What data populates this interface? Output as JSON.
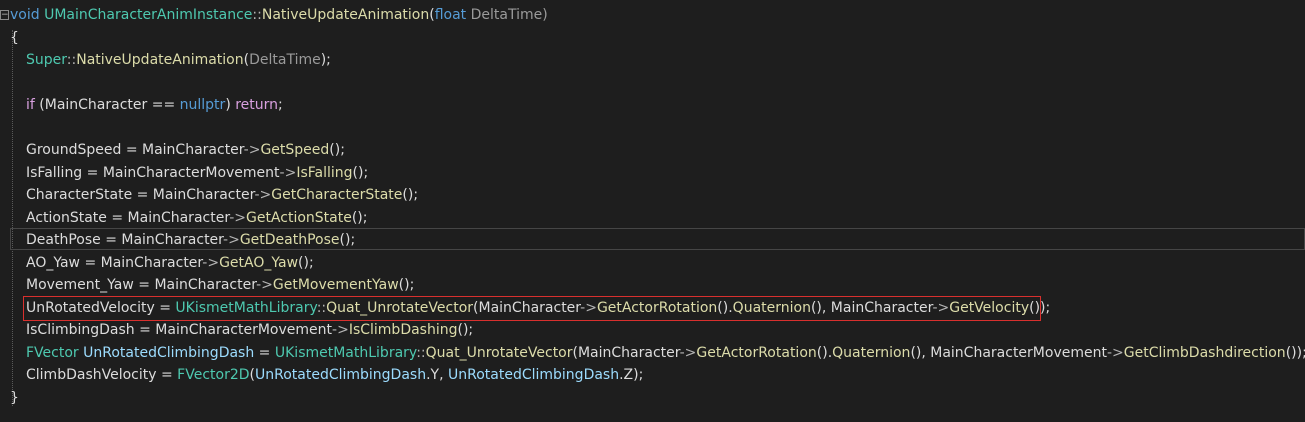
{
  "editor": {
    "lines": [
      [
        {
          "t": "void",
          "c": "kw"
        },
        {
          "t": " ",
          "c": "txt"
        },
        {
          "t": "UMainCharacterAnimInstance",
          "c": "ty"
        },
        {
          "t": "::",
          "c": "op"
        },
        {
          "t": "NativeUpdateAnimation",
          "c": "fn"
        },
        {
          "t": "(",
          "c": "txt"
        },
        {
          "t": "float",
          "c": "kw"
        },
        {
          "t": " DeltaTime)",
          "c": "param"
        }
      ],
      [
        {
          "t": "{",
          "c": "txt"
        }
      ],
      [
        {
          "t": "Super",
          "c": "ty"
        },
        {
          "t": "::",
          "c": "op"
        },
        {
          "t": "NativeUpdateAnimation",
          "c": "fn"
        },
        {
          "t": "(",
          "c": "txt"
        },
        {
          "t": "DeltaTime",
          "c": "param"
        },
        {
          "t": ");",
          "c": "txt"
        }
      ],
      [],
      [
        {
          "t": "if",
          "c": "ctl"
        },
        {
          "t": " (MainCharacter == ",
          "c": "txt"
        },
        {
          "t": "nullptr",
          "c": "kw"
        },
        {
          "t": ") ",
          "c": "txt"
        },
        {
          "t": "return",
          "c": "ctl"
        },
        {
          "t": ";",
          "c": "txt"
        }
      ],
      [],
      [
        {
          "t": "GroundSpeed = MainCharacter",
          "c": "txt"
        },
        {
          "t": "->",
          "c": "op"
        },
        {
          "t": "GetSpeed",
          "c": "fn"
        },
        {
          "t": "();",
          "c": "txt"
        }
      ],
      [
        {
          "t": "IsFalling = MainCharacterMovement",
          "c": "txt"
        },
        {
          "t": "->",
          "c": "op"
        },
        {
          "t": "IsFalling",
          "c": "fn"
        },
        {
          "t": "();",
          "c": "txt"
        }
      ],
      [
        {
          "t": "CharacterState = MainCharacter",
          "c": "txt"
        },
        {
          "t": "->",
          "c": "op"
        },
        {
          "t": "GetCharacterState",
          "c": "fn"
        },
        {
          "t": "();",
          "c": "txt"
        }
      ],
      [
        {
          "t": "ActionState = MainCharacter",
          "c": "txt"
        },
        {
          "t": "->",
          "c": "op"
        },
        {
          "t": "GetActionState",
          "c": "fn"
        },
        {
          "t": "();",
          "c": "txt"
        }
      ],
      [
        {
          "t": "DeathPose = MainCharacter",
          "c": "txt"
        },
        {
          "t": "->",
          "c": "op"
        },
        {
          "t": "GetDeathPose",
          "c": "fn"
        },
        {
          "t": "();",
          "c": "txt"
        }
      ],
      [
        {
          "t": "AO_Yaw = MainCharacter",
          "c": "txt"
        },
        {
          "t": "->",
          "c": "op"
        },
        {
          "t": "GetAO_Yaw",
          "c": "fn"
        },
        {
          "t": "();",
          "c": "txt"
        }
      ],
      [
        {
          "t": "Movement_Yaw = MainCharacter",
          "c": "txt"
        },
        {
          "t": "->",
          "c": "op"
        },
        {
          "t": "GetMovementYaw",
          "c": "fn"
        },
        {
          "t": "();",
          "c": "txt"
        }
      ],
      [
        {
          "t": "UnRotatedVelocity = ",
          "c": "txt"
        },
        {
          "t": "UKismetMathLibrary",
          "c": "ty"
        },
        {
          "t": "::",
          "c": "op"
        },
        {
          "t": "Quat_UnrotateVector",
          "c": "fn"
        },
        {
          "t": "(MainCharacter",
          "c": "txt"
        },
        {
          "t": "->",
          "c": "op"
        },
        {
          "t": "GetActorRotation",
          "c": "fn"
        },
        {
          "t": "().",
          "c": "txt"
        },
        {
          "t": "Quaternion",
          "c": "fn"
        },
        {
          "t": "(), MainCharacter",
          "c": "txt"
        },
        {
          "t": "->",
          "c": "op"
        },
        {
          "t": "GetVelocity",
          "c": "fn"
        },
        {
          "t": "());",
          "c": "txt"
        }
      ],
      [
        {
          "t": "IsClimbingDash = MainCharacterMovement",
          "c": "txt"
        },
        {
          "t": "->",
          "c": "op"
        },
        {
          "t": "IsClimbDashing",
          "c": "fn"
        },
        {
          "t": "();",
          "c": "txt"
        }
      ],
      [
        {
          "t": "FVector",
          "c": "ty"
        },
        {
          "t": " ",
          "c": "txt"
        },
        {
          "t": "UnRotatedClimbingDash",
          "c": "vr"
        },
        {
          "t": " = ",
          "c": "txt"
        },
        {
          "t": "UKismetMathLibrary",
          "c": "ty"
        },
        {
          "t": "::",
          "c": "op"
        },
        {
          "t": "Quat_UnrotateVector",
          "c": "fn"
        },
        {
          "t": "(MainCharacter",
          "c": "txt"
        },
        {
          "t": "->",
          "c": "op"
        },
        {
          "t": "GetActorRotation",
          "c": "fn"
        },
        {
          "t": "().",
          "c": "txt"
        },
        {
          "t": "Quaternion",
          "c": "fn"
        },
        {
          "t": "(), MainCharacterMovement",
          "c": "txt"
        },
        {
          "t": "->",
          "c": "op"
        },
        {
          "t": "GetClimbDashdirection",
          "c": "fn"
        },
        {
          "t": "());",
          "c": "txt"
        }
      ],
      [
        {
          "t": "ClimbDashVelocity = ",
          "c": "txt"
        },
        {
          "t": "FVector2D",
          "c": "ty"
        },
        {
          "t": "(",
          "c": "txt"
        },
        {
          "t": "UnRotatedClimbingDash",
          "c": "vr"
        },
        {
          "t": ".Y, ",
          "c": "txt"
        },
        {
          "t": "UnRotatedClimbingDash",
          "c": "vr"
        },
        {
          "t": ".Z);",
          "c": "txt"
        }
      ],
      [
        {
          "t": "}",
          "c": "txt"
        }
      ]
    ],
    "colors": {
      "background": "#1e1e1e",
      "keyword": "#569cd6",
      "control": "#d8a0df",
      "function": "#dcdcaa",
      "type": "#4ec9b0",
      "variable": "#9cdcfe",
      "highlight_border": "#d9302e"
    }
  }
}
